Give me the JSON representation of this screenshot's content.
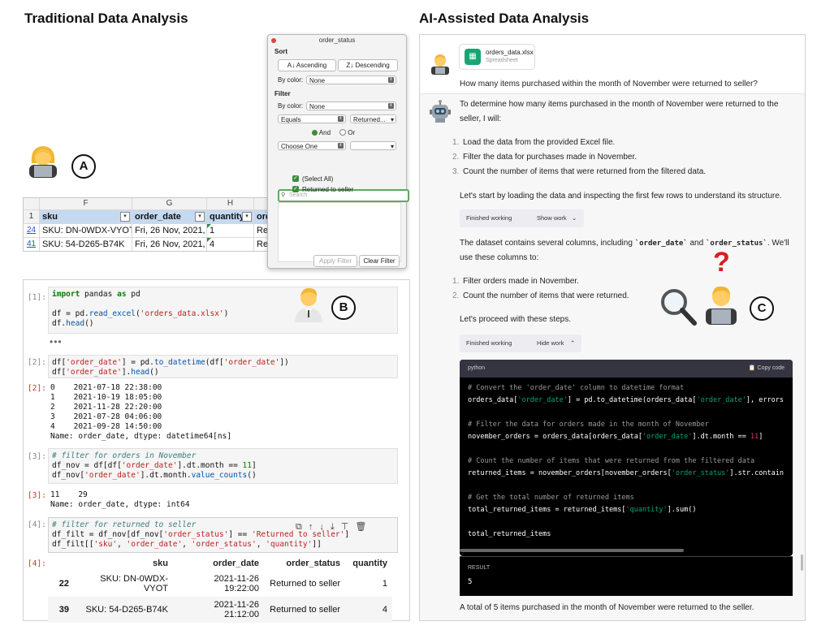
{
  "left_title": "Traditional Data Analysis",
  "right_title": "AI-Assisted Data Analysis",
  "labels": {
    "a": "A",
    "b": "B",
    "c": "C",
    "question_mark": "?"
  },
  "spreadsheet": {
    "col_headers": [
      "F",
      "G",
      "H",
      "I"
    ],
    "header_row_num": "1",
    "fields": [
      "sku",
      "order_date",
      "quantity",
      "order_status"
    ],
    "rows": [
      {
        "rownum": "24",
        "sku": "SKU:  DN-0WDX-VYOT",
        "order_date": "Fri, 26 Nov, 2021,",
        "quantity": "1",
        "order_status": "Returned to seller"
      },
      {
        "rownum": "41",
        "sku": "SKU:  54-D265-B74K",
        "order_date": "Fri, 26 Nov, 2021,",
        "quantity": "4",
        "order_status": "Returned to seller"
      }
    ]
  },
  "filter_popup": {
    "title": "order_status",
    "sort_label": "Sort",
    "ascending": "Ascending",
    "descending": "Descending",
    "by_color": "By color:",
    "none": "None",
    "filter_label": "Filter",
    "equals": "Equals",
    "returned_value": "Returned...",
    "and": "And",
    "or": "Or",
    "choose_one": "Choose One",
    "search_placeholder": "Search",
    "select_all": "(Select All)",
    "returned_to_seller": "Returned to seller",
    "apply_filter": "Apply Filter",
    "clear_filter": "Clear Filter"
  },
  "notebook": {
    "prompts": {
      "p1": "[1]:",
      "p2": "[2]:",
      "p2o": "[2]:",
      "p3": "[3]:",
      "p3o": "[3]:",
      "p4": "[4]:",
      "p4o": "[4]:"
    },
    "ellipsis": "•••",
    "out2_lines": [
      "0    2021-07-18 22:38:00",
      "1    2021-10-19 18:05:00",
      "2    2021-11-28 22:20:00",
      "3    2021-07-28 04:06:00",
      "4    2021-09-28 14:50:00",
      "Name: order_date, dtype: datetime64[ns]"
    ],
    "out3_lines": [
      "11    29",
      "Name: order_date, dtype: int64"
    ],
    "table": {
      "headers": [
        "sku",
        "order_date",
        "order_status",
        "quantity"
      ],
      "rows": [
        {
          "idx": "22",
          "sku": "SKU: DN-0WDX-VYOT",
          "order_date": "2021-11-26 19:22:00",
          "order_status": "Returned to seller",
          "quantity": "1"
        },
        {
          "idx": "39",
          "sku": "SKU: 54-D265-B74K",
          "order_date": "2021-11-26 21:12:00",
          "order_status": "Returned to seller",
          "quantity": "4"
        }
      ]
    }
  },
  "chat": {
    "file_name": "orders_data.xlsx",
    "file_type": "Spreadsheet",
    "question": "How many items purchased within the month of November were returned to seller?",
    "intro_1": "To determine how many items purchased in the month of November were returned to the",
    "intro_2": "seller, I will:",
    "steps": [
      "Load the data from the provided Excel file.",
      "Filter the data for purchases made in November.",
      "Count the number of items that were returned from the filtered data."
    ],
    "step_nums": [
      "1.",
      "2.",
      "3."
    ],
    "lets_start": "Let's start by loading the data and inspecting the first few rows to understand its structure.",
    "finished_working": "Finished working",
    "show_work": "Show work",
    "hide_work": "Hide work",
    "dataset_1_pre": "The dataset contains several columns, including ",
    "col_order_date": "`order_date`",
    "and": " and ",
    "col_order_status": "`order_status`",
    "dataset_1_post": ". We'll",
    "dataset_2": "use these columns to:",
    "steps2": [
      "Filter orders made in November.",
      "Count the number of items that were returned."
    ],
    "proceed": "Let's proceed with these steps.",
    "code_lang": "python",
    "copy_code": "Copy code",
    "result_label": "RESULT",
    "result_value": "5",
    "final": "A total of 5 items purchased in the month of November were returned to the seller."
  }
}
